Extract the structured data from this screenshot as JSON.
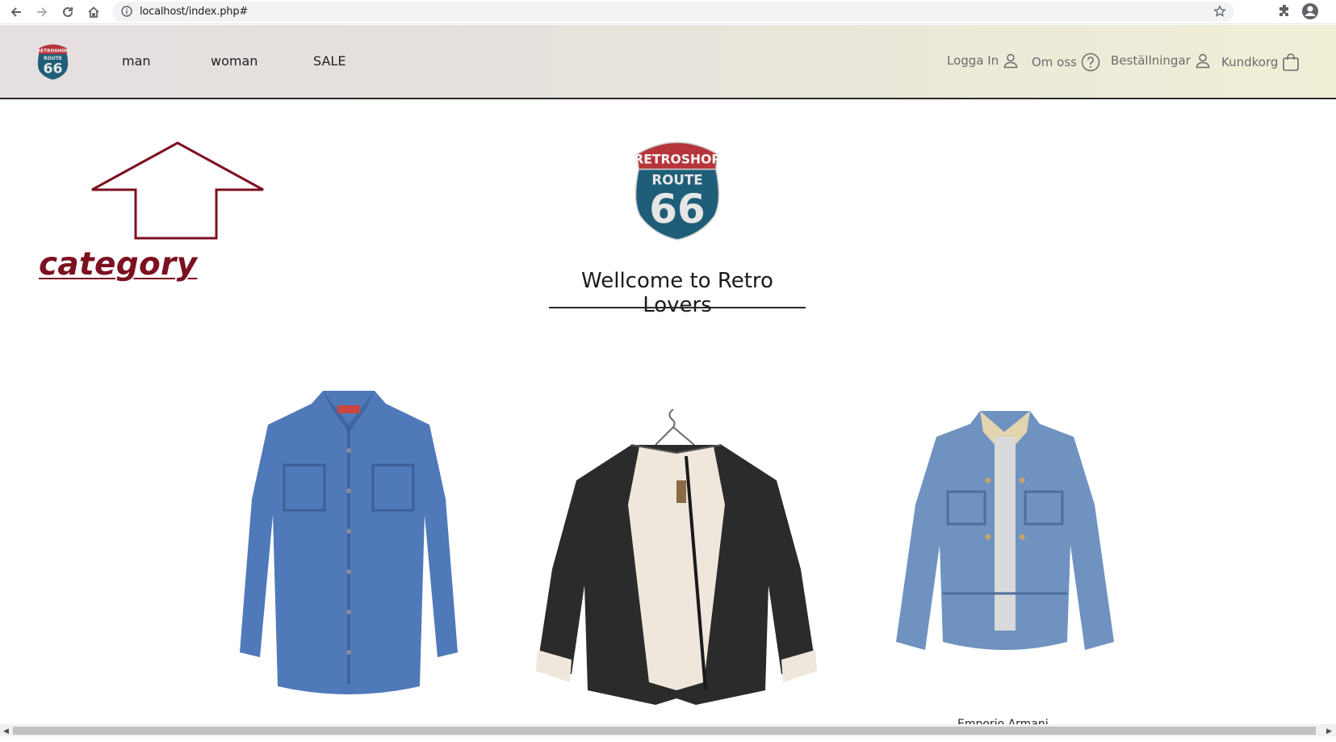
{
  "browser": {
    "url": "localhost/index.php#",
    "icons": [
      "back-icon",
      "forward-icon",
      "reload-icon",
      "home-icon",
      "info-icon",
      "star-icon",
      "extensions-icon",
      "profile-icon"
    ]
  },
  "header": {
    "logo_text_top": "RETROSHOP",
    "logo_text_mid": "ROUTE",
    "logo_text_num": "66",
    "nav": [
      {
        "label": "man"
      },
      {
        "label": "woman"
      },
      {
        "label": "SALE"
      }
    ],
    "right_nav": [
      {
        "label": "Logga In",
        "icon": "user-icon"
      },
      {
        "label": "Om oss",
        "icon": "question-icon"
      },
      {
        "label": "Beställningar",
        "icon": "user-icon"
      },
      {
        "label": "Kundkorg",
        "icon": "bag-icon"
      }
    ]
  },
  "annotation": {
    "label": "category",
    "color": "#7c1020"
  },
  "hero": {
    "logo_text_top": "RETROSHOP",
    "logo_text_mid": "ROUTE",
    "logo_text_num": "66",
    "welcome": "Wellcome to Retro Lovers"
  },
  "products": [
    {
      "name": "denim-shirt"
    },
    {
      "name": "leather-shearling-jacket"
    },
    {
      "name": "denim-jacket",
      "caption": "Emporio Armani"
    }
  ],
  "colors": {
    "shield_red": "#b5353a",
    "shield_blue": "#1f5e78",
    "accent": "#7c1020"
  }
}
